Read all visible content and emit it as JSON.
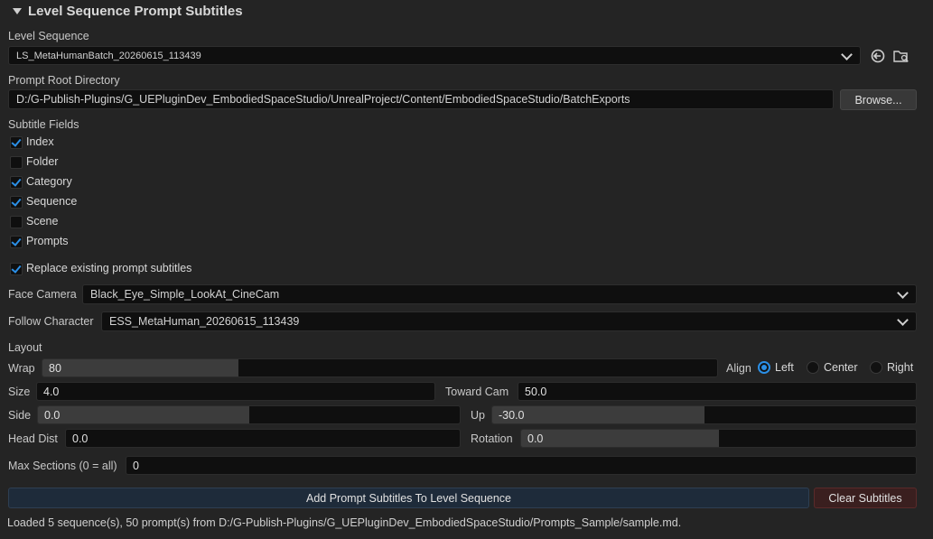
{
  "section": {
    "title": "Level Sequence Prompt Subtitles"
  },
  "level_sequence": {
    "label": "Level Sequence",
    "value": "LS_MetaHumanBatch_20260615_113439"
  },
  "icons": {
    "browse_sequence": "back-arrow-icon",
    "find_asset": "folder-search-icon"
  },
  "prompt_root": {
    "label": "Prompt Root Directory",
    "value": "D:/G-Publish-Plugins/G_UEPluginDev_EmbodiedSpaceStudio/UnrealProject/Content/EmbodiedSpaceStudio/BatchExports",
    "browse_label": "Browse..."
  },
  "subtitle_fields": {
    "label": "Subtitle Fields",
    "items": [
      {
        "label": "Index",
        "checked": true
      },
      {
        "label": "Folder",
        "checked": false
      },
      {
        "label": "Category",
        "checked": true
      },
      {
        "label": "Sequence",
        "checked": true
      },
      {
        "label": "Scene",
        "checked": false
      },
      {
        "label": "Prompts",
        "checked": true
      }
    ]
  },
  "replace_existing": {
    "label": "Replace existing prompt subtitles",
    "checked": true
  },
  "face_camera": {
    "label": "Face Camera",
    "value": "Black_Eye_Simple_LookAt_CineCam"
  },
  "follow_character": {
    "label": "Follow Character",
    "value": "ESS_MetaHuman_20260615_113439"
  },
  "layout": {
    "label": "Layout",
    "wrap": {
      "label": "Wrap",
      "value": "80",
      "fill_fraction": 0.29
    },
    "align": {
      "label": "Align",
      "options": [
        "Left",
        "Center",
        "Right"
      ],
      "selected": "Left"
    },
    "size": {
      "label": "Size",
      "value": "4.0"
    },
    "toward_cam": {
      "label": "Toward Cam",
      "value": "50.0"
    },
    "side": {
      "label": "Side",
      "value": "0.0",
      "fill_fraction": 0.5
    },
    "up": {
      "label": "Up",
      "value": "-30.0",
      "fill_fraction": 0.5
    },
    "head_dist": {
      "label": "Head Dist",
      "value": "0.0"
    },
    "rotation": {
      "label": "Rotation",
      "value": "0.0",
      "fill_fraction": 0.5
    },
    "max_sections": {
      "label": "Max Sections (0 = all)",
      "value": "0"
    }
  },
  "actions": {
    "add_label": "Add Prompt Subtitles To Level Sequence",
    "clear_label": "Clear Subtitles"
  },
  "status": "Loaded 5 sequence(s), 50 prompt(s) from D:/G-Publish-Plugins/G_UEPluginDev_EmbodiedSpaceStudio/Prompts_Sample/sample.md.",
  "colors": {
    "accent": "#2b8fe6",
    "background": "#242424",
    "field": "#0f0f0f"
  }
}
